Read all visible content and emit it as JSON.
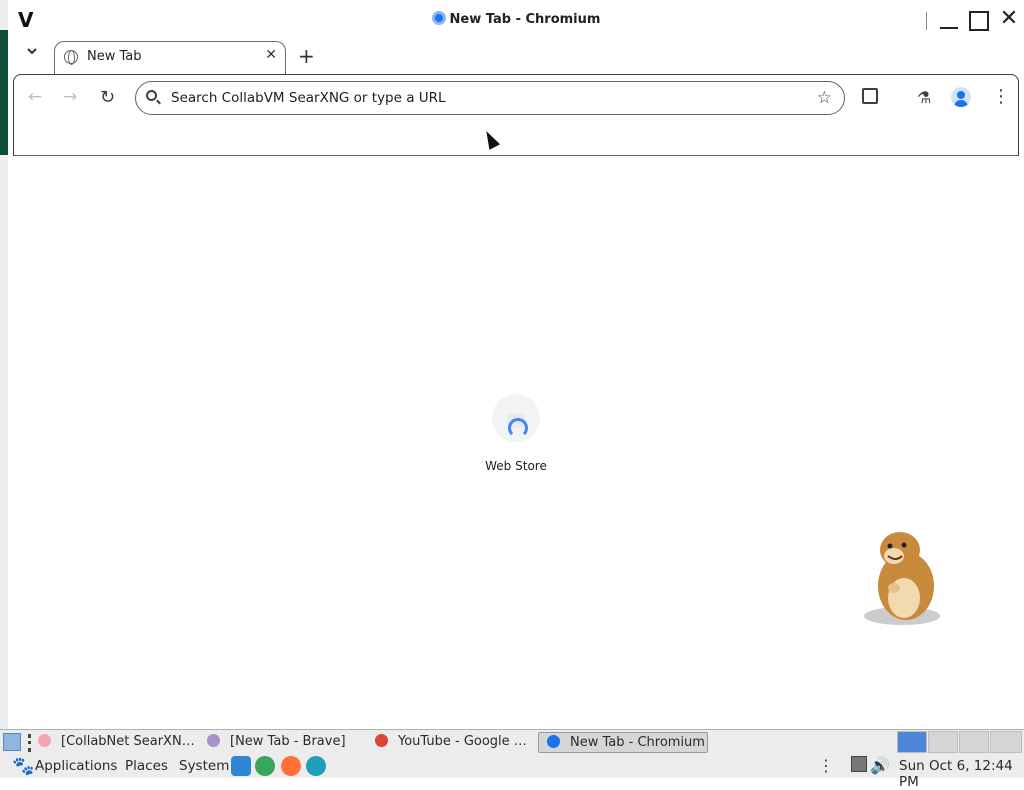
{
  "window": {
    "app_letter": "V",
    "title": "New Tab - Chromium",
    "minimize": "",
    "maximize": "",
    "close": "✕"
  },
  "tabs": {
    "list_menu": "⌄",
    "items": [
      {
        "label": "New Tab",
        "close": "✕"
      }
    ],
    "new_tab": "+"
  },
  "toolbar": {
    "back": "←",
    "forward": "→",
    "reload": "↻",
    "omnibox_placeholder": "Search CollabVM SearXNG or type a URL",
    "bookmark": "☆",
    "labs": "⚗",
    "menu": "⋮"
  },
  "page": {
    "shortcut_label": "Web Store"
  },
  "taskbar": {
    "items": [
      {
        "label": "[CollabNet SearXN…",
        "icon": "searxng-icon",
        "color": "#f4a6b0"
      },
      {
        "label": "[New Tab - Brave]",
        "icon": "brave-icon",
        "color": "#a792c8"
      },
      {
        "label": "YouTube - Google …",
        "icon": "chrome-icon",
        "color": "#db4437"
      },
      {
        "label": "New Tab - Chromium",
        "icon": "chromium-icon",
        "color": "#1a73e8",
        "active": true
      }
    ]
  },
  "panel": {
    "menus": [
      "Applications",
      "Places",
      "System"
    ],
    "clock": "Sun Oct  6, 12:44 PM",
    "tray_menu": "⋮",
    "volume": "🔊"
  },
  "colors": {
    "accent": "#1a73e8",
    "workspace_active": "#4d86d6",
    "desktop_green": "#0f4d3b"
  }
}
